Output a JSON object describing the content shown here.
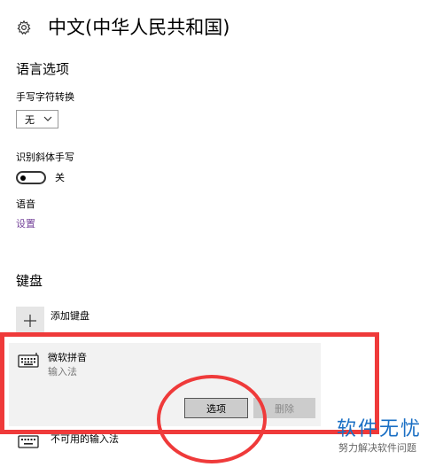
{
  "header": {
    "title": "中文(中华人民共和国)",
    "icon": "gear-icon"
  },
  "language_options": {
    "heading": "语言选项",
    "handwriting_conversion": {
      "label": "手写字符转换",
      "value": "无"
    },
    "italic_handwriting": {
      "label": "识别斜体手写",
      "state": "关"
    },
    "speech": {
      "label": "语音",
      "link": "设置"
    }
  },
  "keyboard": {
    "heading": "键盘",
    "add_label": "添加键盘",
    "items": [
      {
        "name": "微软拼音",
        "type": "输入法",
        "icon": "keyboard-icon"
      }
    ],
    "options_button": "选项",
    "delete_button": "删除",
    "unavailable_label": "不可用的输入法"
  },
  "watermark": {
    "main": "软件无忧",
    "sub": "努力解决软件问题"
  },
  "colors": {
    "link": "#76449b",
    "annotation": "#ef3a3a",
    "watermark": "#1a6fc4",
    "panel": "#f2f2f2"
  }
}
